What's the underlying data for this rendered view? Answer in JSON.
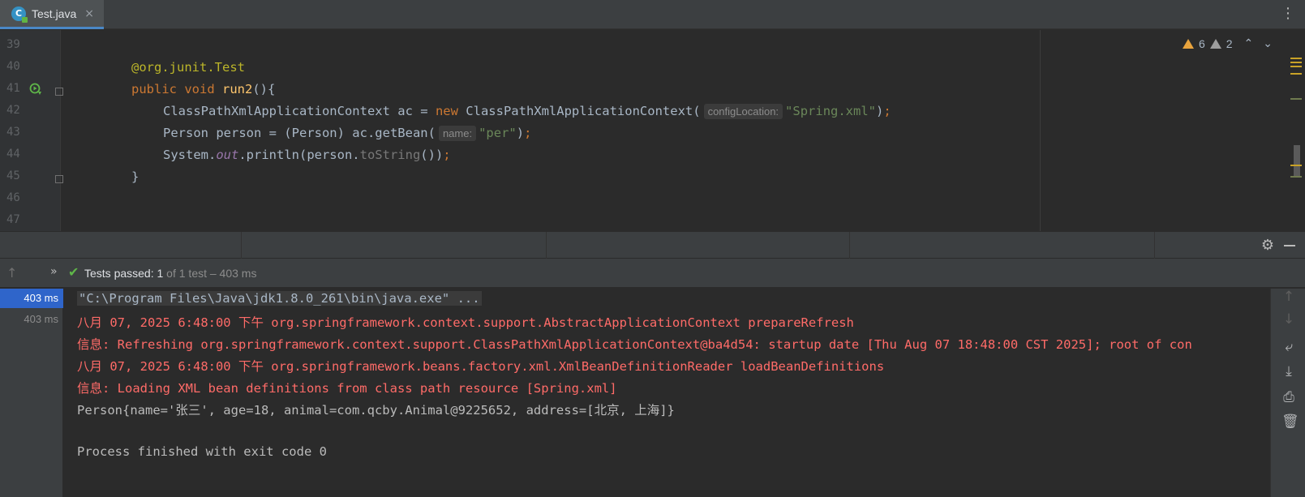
{
  "tab": {
    "label": "Test.java",
    "icon": "java-class-icon",
    "close": "×"
  },
  "editor": {
    "line_numbers": [
      "39",
      "40",
      "41",
      "42",
      "43",
      "44",
      "45",
      "46",
      "47"
    ],
    "annotation": "@org.junit.",
    "annotation_name": "Test",
    "kw_public": "public",
    "kw_void": "void",
    "method_name": "run2",
    "method_tail": "(){",
    "line42_a": "ClassPathXmlApplicationContext ac = ",
    "kw_new": "new",
    "line42_b": " ClassPathXmlApplicationContext(",
    "hint_config": "configLocation:",
    "line42_str": "\"Spring.xml\"",
    "line42_end": ")",
    "semicolon": ";",
    "line43_a": "Person person = (Person) ac.getBean(",
    "hint_name": "name:",
    "line43_str": "\"per\"",
    "line43_end": ")",
    "line44_a": "System.",
    "line44_out": "out",
    "line44_b": ".println(person.",
    "line44_tostring": "toString",
    "line44_end": "())",
    "line45": "}",
    "warnings_count": "6",
    "weak_warnings_count": "2"
  },
  "status": {
    "check": "✔",
    "label": "Tests passed: ",
    "passed": "1",
    "detail": " of 1 test – 403 ms"
  },
  "tests": [
    {
      "time": "403 ms",
      "selected": true
    },
    {
      "time": "403 ms",
      "selected": false
    }
  ],
  "console": {
    "lines": [
      "\"C:\\Program Files\\Java\\jdk1.8.0_261\\bin\\java.exe\" ...",
      "八月 07, 2025 6:48:00 下午 org.springframework.context.support.AbstractApplicationContext prepareRefresh",
      "信息: Refreshing org.springframework.context.support.ClassPathXmlApplicationContext@ba4d54: startup date [Thu Aug 07 18:48:00 CST 2025]; root of con",
      "八月 07, 2025 6:48:00 下午 org.springframework.beans.factory.xml.XmlBeanDefinitionReader loadBeanDefinitions",
      "信息: Loading XML bean definitions from class path resource [Spring.xml]",
      "Person{name='张三', age=18, animal=com.qcby.Animal@9225652, address=[北京, 上海]}",
      "",
      "Process finished with exit code 0"
    ]
  },
  "colors": {
    "accent": "#4a88c7",
    "pass": "#5fb649",
    "error": "#ff6b68",
    "selection": "#2f65ca"
  }
}
